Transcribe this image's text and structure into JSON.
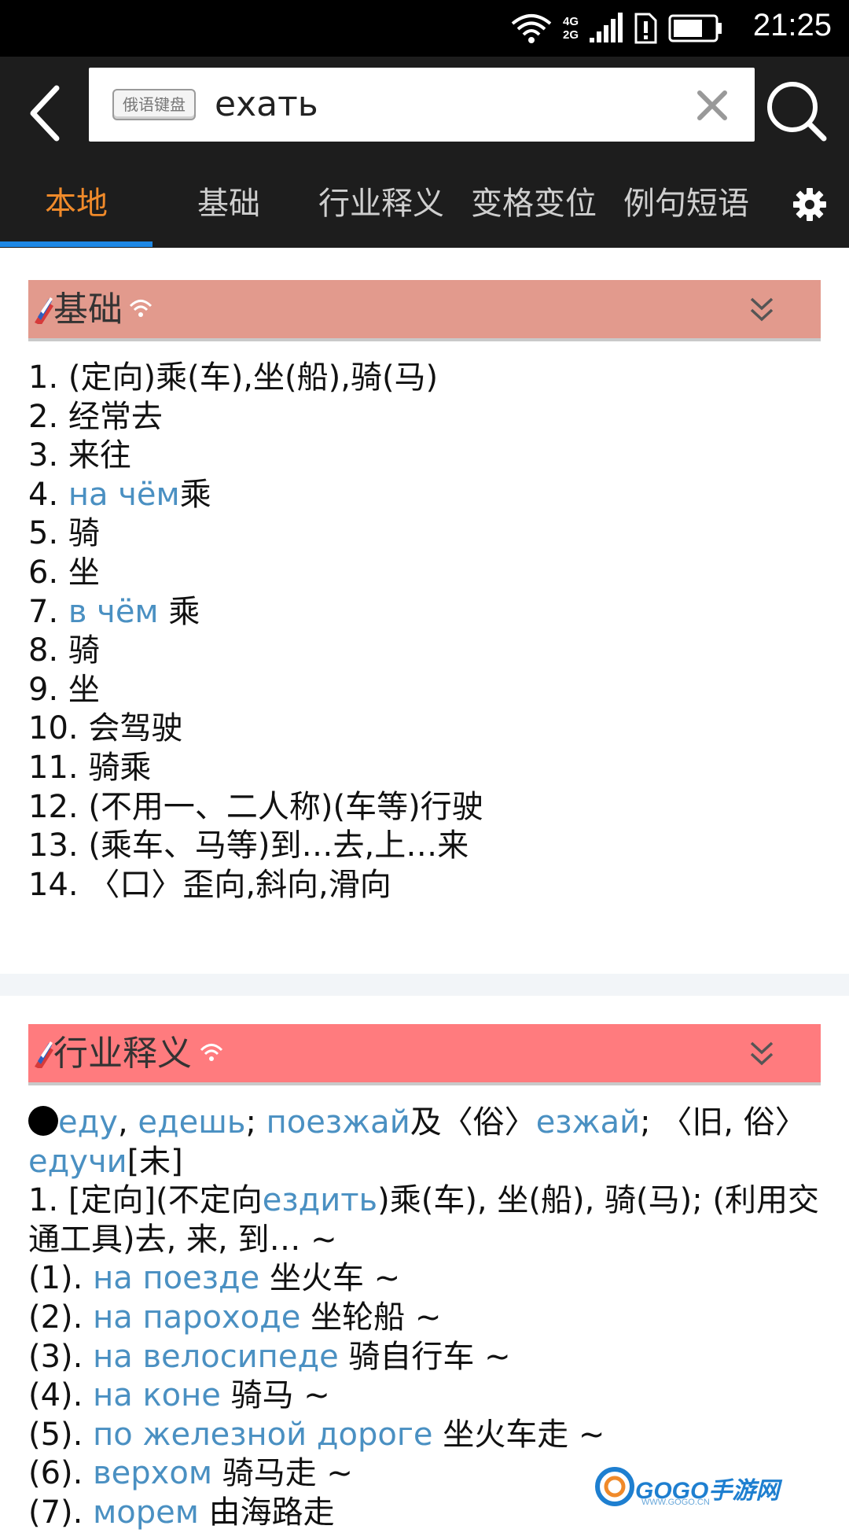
{
  "status_bar": {
    "time": "21:25",
    "net_top": "4G",
    "net_bottom": "2G"
  },
  "search": {
    "keyboard_badge": "俄语键盘",
    "query": "ехать"
  },
  "tabs": [
    {
      "label": "本地",
      "active": true
    },
    {
      "label": "基础",
      "active": false
    },
    {
      "label": "行业释义",
      "active": false
    },
    {
      "label": "变格变位",
      "active": false
    },
    {
      "label": "例句短语",
      "active": false
    }
  ],
  "colors": {
    "header_bg": "#1d1d1d",
    "active_tab": "#f08a2a",
    "indicator": "#1e88e5",
    "section1_bg": "#e29a8d",
    "section2_bg": "#ff7b7e",
    "russian_link": "#4a90c2"
  },
  "section_basic": {
    "title": "基础",
    "items": [
      {
        "n": "1. ",
        "text": "(定向)乘(车),坐(船),骑(马)"
      },
      {
        "n": "2. ",
        "text": "经常去"
      },
      {
        "n": "3. ",
        "text": "来往"
      },
      {
        "n": "4. ",
        "ru": "на чём",
        "text": "乘"
      },
      {
        "n": "5. ",
        "text": "骑"
      },
      {
        "n": "6. ",
        "text": "坐"
      },
      {
        "n": "7. ",
        "ru": "в чём ",
        "text": " 乘"
      },
      {
        "n": "8. ",
        "text": "骑"
      },
      {
        "n": "9. ",
        "text": "坐"
      },
      {
        "n": "10. ",
        "text": "会驾驶"
      },
      {
        "n": "11. ",
        "text": "骑乘"
      },
      {
        "n": "12. ",
        "text": "(不用一、二人称)(车等)行驶"
      },
      {
        "n": "13. ",
        "text": "(乘车、马等)到…去,上…来"
      },
      {
        "n": "14. ",
        "text": "〈口〉歪向,斜向,滑向"
      }
    ]
  },
  "section_industry": {
    "title": "行业释义",
    "forms": {
      "edu": "еду",
      "sep1": ", ",
      "edesh": "едешь",
      "sep2": "; ",
      "poezzhai": "поезжай",
      "and_colloq": "及〈俗〉",
      "ezzhai": "езжай",
      "old_colloq": "; 〈旧, 俗〉",
      "educhi": "едучи",
      "aspect": "[未]"
    },
    "def1": {
      "pre": "1. [定向](不定向",
      "ru": "ездить",
      "post": ")乘(车), 坐(船), 骑(马); (利用交通工具)去, 来, 到… ~"
    },
    "examples": [
      {
        "n": "(1). ",
        "ru": "на поезде",
        "zh": " 坐火车 ~"
      },
      {
        "n": "(2). ",
        "ru": "на пароходе",
        "zh": " 坐轮船 ~"
      },
      {
        "n": "(3). ",
        "ru": "на велосипеде",
        "zh": " 骑自行车 ~"
      },
      {
        "n": "(4). ",
        "ru": "на коне",
        "zh": " 骑马 ~"
      },
      {
        "n": "(5). ",
        "ru": "по железной дороге",
        "zh": " 坐火车走 ~"
      },
      {
        "n": "(6). ",
        "ru": "верхом",
        "zh": " 骑马走 ~"
      },
      {
        "n": "(7). ",
        "ru": "морем",
        "zh": " 由海路走"
      }
    ]
  },
  "watermark": {
    "text": "GOGO手游网",
    "sub": "WWW.GOGO.CN"
  }
}
